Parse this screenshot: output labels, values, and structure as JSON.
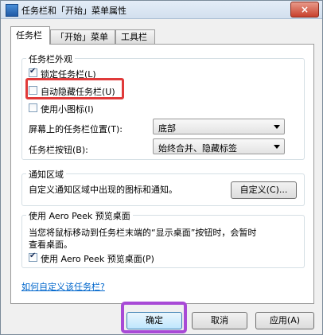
{
  "window": {
    "title": "任务栏和「开始」菜单属性",
    "close_glyph": "×"
  },
  "tabs": [
    {
      "label": "任务栏",
      "active": true
    },
    {
      "label": "「开始」菜单",
      "active": false
    },
    {
      "label": "工具栏",
      "active": false
    }
  ],
  "appearance": {
    "title": "任务栏外观",
    "lock_taskbar": {
      "label": "锁定任务栏(L)",
      "checked": true
    },
    "auto_hide": {
      "label": "自动隐藏任务栏(U)",
      "checked": false
    },
    "small_icons": {
      "label": "使用小图标(I)",
      "checked": false
    },
    "location_label": "屏幕上的任务栏位置(T):",
    "location_value": "底部",
    "buttons_label": "任务栏按钮(B):",
    "buttons_value": "始终合并、隐藏标签"
  },
  "notification": {
    "title": "通知区域",
    "description": "自定义通知区域中出现的图标和通知。",
    "customize_label": "自定义(C)..."
  },
  "aero_peek": {
    "title": "使用 Aero Peek 预览桌面",
    "description_line1": "当您将鼠标移动到任务栏末端的“显示桌面”按钮时，会暂时",
    "description_line2": "查看桌面。",
    "checkbox": {
      "label": "使用 Aero Peek 预览桌面(P)",
      "checked": true
    }
  },
  "help_link": "如何自定义该任务栏?",
  "footer": {
    "ok_label": "确定",
    "cancel_label": "取消",
    "apply_label": "应用(A)"
  },
  "colors": {
    "highlight_red": "#e03a3a",
    "highlight_purple": "#a84ad6",
    "link": "#0066cc"
  },
  "icons": {
    "app": "taskbar-properties-icon",
    "close": "close-icon"
  }
}
